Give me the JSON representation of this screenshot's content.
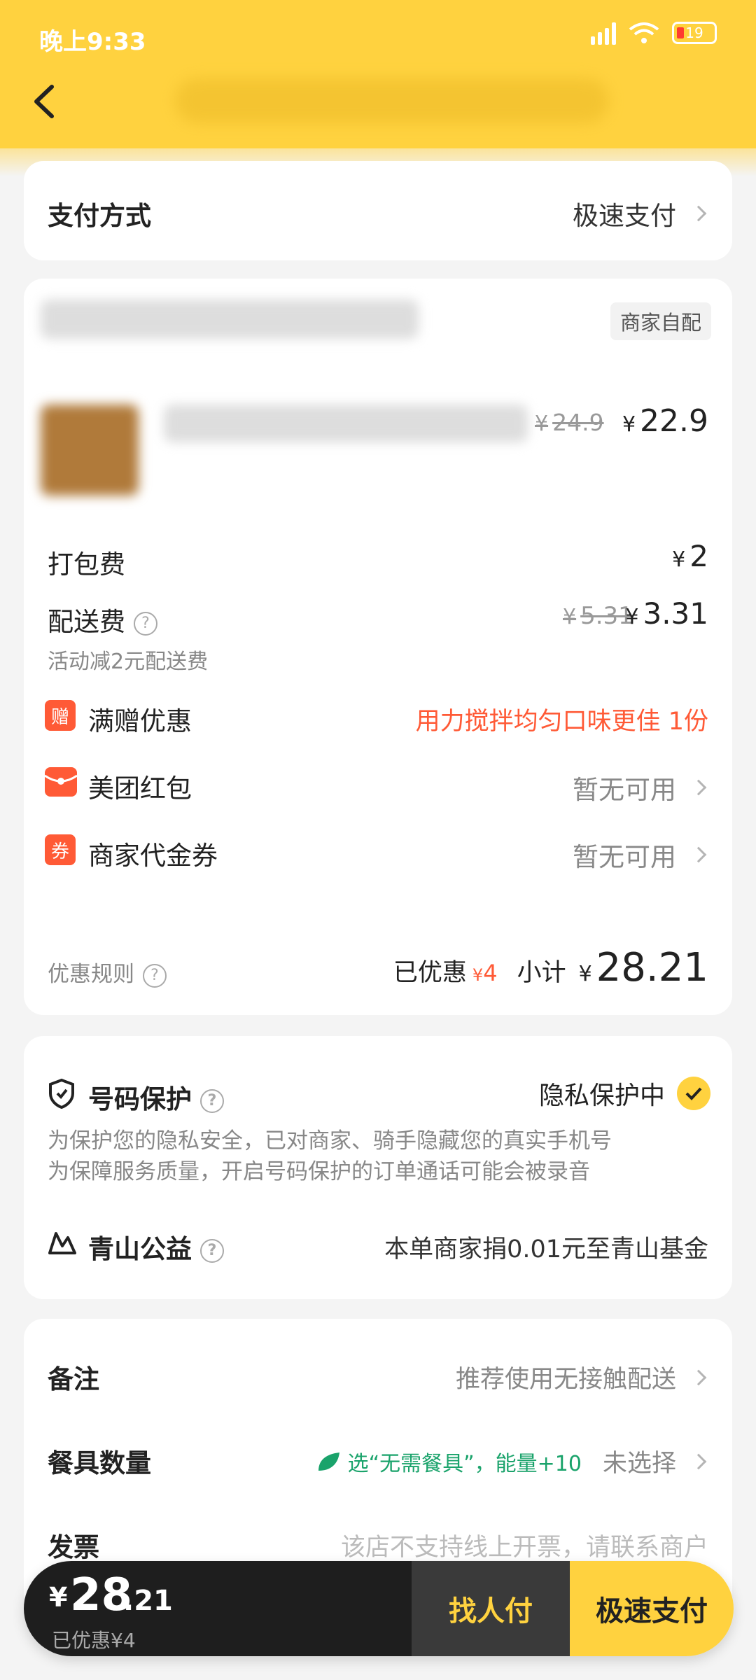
{
  "status": {
    "time": "晚上9:33",
    "battery": "19"
  },
  "payment": {
    "label": "支付方式",
    "value": "极速支付"
  },
  "order": {
    "delivery_tag": "商家自配",
    "item_original_price": "24.9",
    "item_price": "22.9",
    "packing": {
      "label": "打包费",
      "value": "2"
    },
    "delivery": {
      "label": "配送费",
      "original": "5.31",
      "value": "3.31",
      "note": "活动减2元配送费"
    },
    "gift": {
      "badge": "赠",
      "label": "满赠优惠",
      "value": "用力搅拌均匀口味更佳 1份"
    },
    "redpacket": {
      "label": "美团红包",
      "value": "暂无可用"
    },
    "voucher": {
      "badge": "券",
      "label": "商家代金券",
      "value": "暂无可用"
    },
    "rules_label": "优惠规则",
    "discounted_label": "已优惠",
    "discounted_value": "4",
    "subtotal_label": "小计",
    "subtotal_value": "28.21"
  },
  "privacy": {
    "label": "号码保护",
    "status": "隐私保护中",
    "line1": "为保护您的隐私安全，已对商家、骑手隐藏您的真实手机号",
    "line2": "为保障服务质量，开启号码保护的订单通话可能会被录音"
  },
  "charity": {
    "label": "青山公益",
    "value": "本单商家捐0.01元至青山基金"
  },
  "extras": {
    "note_label": "备注",
    "note_value": "推荐使用无接触配送",
    "utensils_label": "餐具数量",
    "utensils_hint": "选“无需餐具”，能量+10",
    "utensils_value": "未选择",
    "invoice_label": "发票",
    "invoice_value": "该店不支持线上开票，请联系商户"
  },
  "bottom": {
    "currency": "¥",
    "total_int": "28",
    "total_dec": ".21",
    "discount": "已优惠¥4",
    "find_pay": "找人付",
    "fast_pay": "极速支付"
  },
  "colors": {
    "brand": "#ffd23f",
    "accent_red": "#ff5a36",
    "green": "#1aa36b"
  }
}
